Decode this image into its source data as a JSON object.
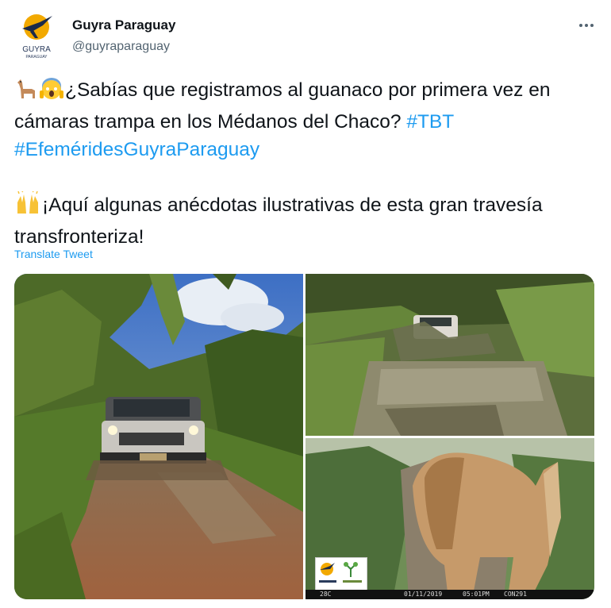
{
  "author": {
    "name": "Guyra Paraguay",
    "handle": "@guyraparaguay",
    "avatar_text_top": "GUYRA",
    "avatar_text_bottom": "PARAGUAY"
  },
  "tweet": {
    "line1_text": "¿Sabías que registramos al guanaco por primera vez en cámaras trampa en los Médanos del Chaco? ",
    "hashtag1": "#TBT",
    "hashtag2": "#EfeméridesGuyraParaguay",
    "line2_text": "¡Aquí algunas anécdotas ilustrativas de esta gran travesía transfronteriza!",
    "emojis": [
      "llama-emoji",
      "screaming-face-emoji",
      "raising-hands-emoji"
    ]
  },
  "translate_label": "Translate Tweet",
  "camera_stamp": {
    "temp": "28C",
    "date": "01/11/2019",
    "time": "05:01PM",
    "id": "CON291"
  },
  "colors": {
    "link": "#1d9bf0",
    "text": "#0f1419",
    "secondary": "#536471"
  }
}
